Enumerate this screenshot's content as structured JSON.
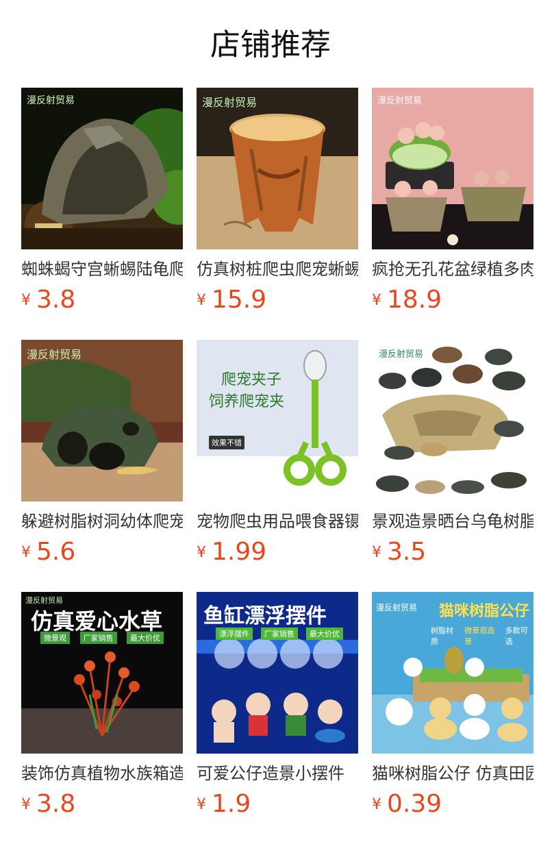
{
  "header": {
    "title": "店铺推荐"
  },
  "products": [
    {
      "name": "蜘蛛蝎守宫蜥蜴陆龟爬宠",
      "currency": "¥",
      "price": "3.8",
      "badge": "漫反射贸易"
    },
    {
      "name": "仿真树桩爬虫爬宠蜥蜴",
      "currency": "¥",
      "price": "15.9",
      "badge": "漫反射贸易"
    },
    {
      "name": "疯抢无孔花盆绿植多肉",
      "currency": "¥",
      "price": "18.9",
      "badge": "漫反射贸易"
    },
    {
      "name": "躲避树脂树洞幼体爬宠",
      "currency": "¥",
      "price": "5.6",
      "badge": "漫反射贸易"
    },
    {
      "name": "宠物爬虫用品喂食器镊",
      "currency": "¥",
      "price": "1.99",
      "img_title_1": "爬宠夹子",
      "img_title_2": "饲养爬宠夹",
      "img_tag": "效果不错"
    },
    {
      "name": "景观造景晒台乌龟树脂",
      "currency": "¥",
      "price": "3.5",
      "badge": "漫反射贸易"
    },
    {
      "name": "装饰仿真植物水族箱造",
      "currency": "¥",
      "price": "3.8",
      "badge": "漫反射贸易",
      "img_title": "仿真爱心水草",
      "img_tags": [
        "微景观",
        "厂家销售",
        "最大价优"
      ]
    },
    {
      "name": "可爱公仔造景小摆件",
      "currency": "¥",
      "price": "1.9",
      "img_title": "鱼缸漂浮摆件",
      "img_tags": [
        "漂浮摆件",
        "厂家销售",
        "最大价优"
      ]
    },
    {
      "name": "猫咪树脂公仔 仿真田园",
      "currency": "¥",
      "price": "0.39",
      "badge": "漫反射贸易",
      "img_title": "猫咪树脂公仔",
      "img_sub": [
        "树脂材质",
        "微景观造景",
        "多款可选"
      ]
    }
  ],
  "colors": {
    "price": "#e8471b",
    "title": "#111111"
  }
}
